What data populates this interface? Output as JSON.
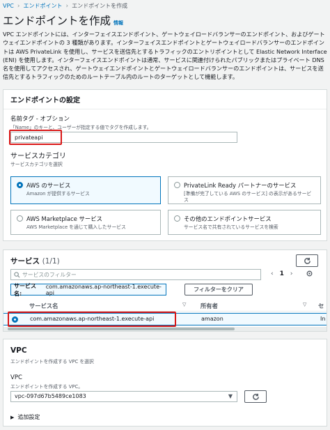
{
  "breadcrumb": {
    "vpc": "VPC",
    "endpoints": "エンドポイント",
    "current": "エンドポイントを作成"
  },
  "header": {
    "title": "エンドポイントを作成",
    "info": "情報"
  },
  "description": "VPC エンドポイントには、インターフェイスエンドポイント、ゲートウェイロードバランサーのエンドポイント、およびゲートウェイエンドポイントの 3 種類があります。インターフェイスエンドポイントとゲートウェイロードバランサーのエンドポイントは AWS PrivateLink を使用し、サービスを送信先とするトラフィックのエントリポイントとして Elastic Network Interface (ENI) を使用します。インターフェイスエンドポイントは通常、サービスに関連付けられたパブリックまたはプライベート DNS 名を使用してアクセスされ、ゲートウェイエンドポイントとゲートウェイロードバランサーのエンドポイントは、サービスを送信先とするトラフィックのためのルートテーブル内のルートのターゲットとして機能します。",
  "settings": {
    "title": "エンドポイントの設定",
    "name_label": "名前タグ - オプション",
    "name_hint": "「Name」のキーと、ユーザーが指定する値でタグを作成します。",
    "name_value": "privateapi",
    "category_label": "サービスカテゴリ",
    "category_hint": "サービスカテゴリを選択",
    "tiles": [
      {
        "title": "AWS のサービス",
        "sub": "Amazon が提供するサービス"
      },
      {
        "title": "PrivateLink Ready パートナーのサービス",
        "sub": "[準備が完了している AWS のサービス] の表示があるサービス"
      },
      {
        "title": "AWS Marketplace サービス",
        "sub": "AWS Marketplace を通じて購入したサービス"
      },
      {
        "title": "その他のエンドポイントサービス",
        "sub": "サービス名で共有されているサービスを検索"
      }
    ]
  },
  "services": {
    "title": "サービス",
    "count": "(1/1)",
    "filter_placeholder": "サービスのフィルター",
    "page": "1",
    "token_label": "サービス名:",
    "token_value": "com.amazonaws.ap-northeast-1.execute-api",
    "clear_filter": "フィルターをクリア",
    "col_name": "サービス名",
    "col_owner": "所有者",
    "row_name": "com.amazonaws.ap-northeast-1.execute-api",
    "row_owner": "amazon",
    "row_extra": "In"
  },
  "vpc": {
    "title": "VPC",
    "hint": "エンドポイントを作成する VPC を選択",
    "label": "VPC",
    "sub": "エンドポイントを作成する VPC。",
    "value": "vpc-097d67b5489ce1083",
    "additional": "追加設定"
  },
  "colors": {
    "accent": "#0073bb",
    "highlight": "#d91515"
  }
}
